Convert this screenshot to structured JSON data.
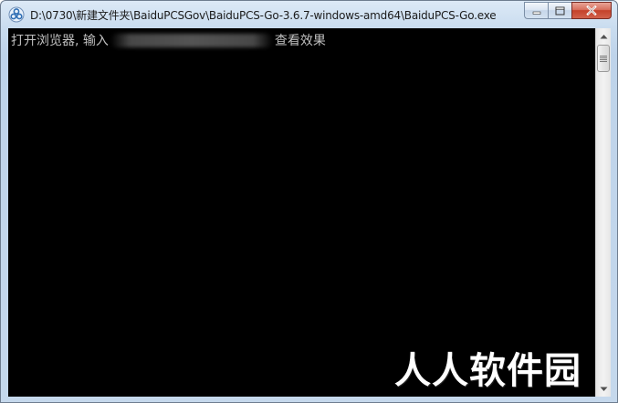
{
  "window": {
    "title": "D:\\0730\\新建文件夹\\BaiduPCSGov\\BaiduPCS-Go-3.6.7-windows-amd64\\BaiduPCS-Go.exe",
    "app_icon": "baidu-pcs-icon",
    "frame_color": "#c5d8ec",
    "close_button_color": "#c4412a"
  },
  "caption_buttons": {
    "minimize_icon": "minimize-icon",
    "maximize_icon": "maximize-icon",
    "close_icon": "close-icon"
  },
  "console": {
    "background": "#000000",
    "text_color": "#c0c0c0",
    "line_prefix": "打开浏览器, 输入",
    "line_suffix": "查看效果"
  },
  "scrollbar": {
    "up_icon": "scroll-up-arrow-icon",
    "down_icon": "scroll-down-arrow-icon"
  },
  "watermark": {
    "text": "人人软件园"
  }
}
